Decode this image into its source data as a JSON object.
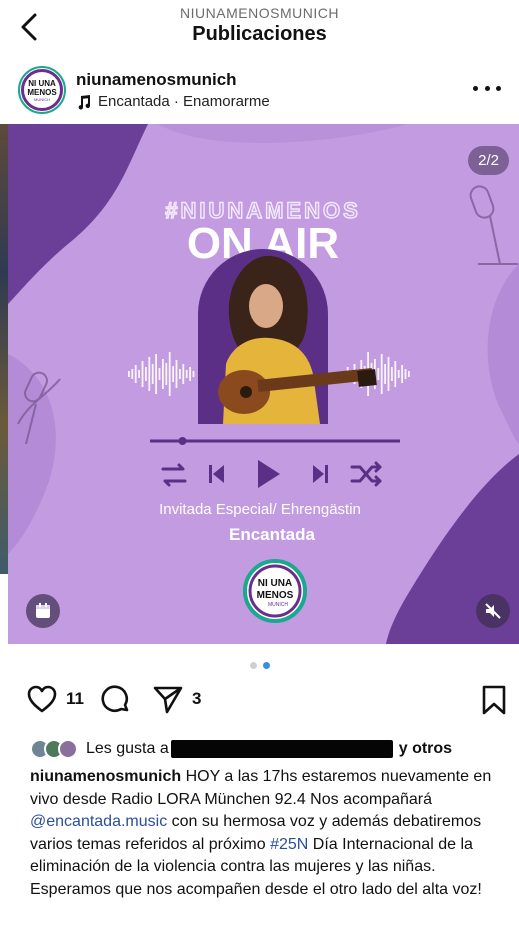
{
  "header": {
    "account": "NIUNAMENOSMUNICH",
    "title": "Publicaciones"
  },
  "post": {
    "username": "niunamenosmunich",
    "music": "Encantada · Enamorarme",
    "counter": "2/2"
  },
  "artwork": {
    "hashtag": "#NIUNAMENOS",
    "headline": "ON AIR",
    "guest_label": "Invitada Especial/ Ehrengästin",
    "guest_name": "Encantada",
    "logo": {
      "line1": "NI UNA",
      "line2": "MENOS",
      "line3": "MUNICH"
    },
    "player_progress": 0.13
  },
  "carousel": {
    "total": 2,
    "current": 2
  },
  "actions": {
    "likes_count": "11",
    "shares_count": "3"
  },
  "likes_line": {
    "prefix": "Les gusta a",
    "suffix": "y otros"
  },
  "caption": {
    "username": "niunamenosmunich",
    "part1": " HOY a las 17hs estaremos nuevamente en vivo desde Radio LORA München 92.4 Nos acompañará ",
    "mention": "@encantada.music",
    "part2": " con su hermosa voz y además debatiremos varios temas referidos al próximo ",
    "hashtag": "#25N",
    "part3": " Día Internacional de la eliminación de la violencia contra las mujeres y las niñas.",
    "line2": "Esperamos que nos acompañen desde el otro lado del alta voz!"
  },
  "colors": {
    "bg_purple": "#c29be0",
    "dark_purple": "#6b3f98",
    "deep_purple": "#4e2a78",
    "accent_green": "#1aa88f",
    "link_blue": "#2b4f9a",
    "dot_active": "#3a8fd6"
  }
}
